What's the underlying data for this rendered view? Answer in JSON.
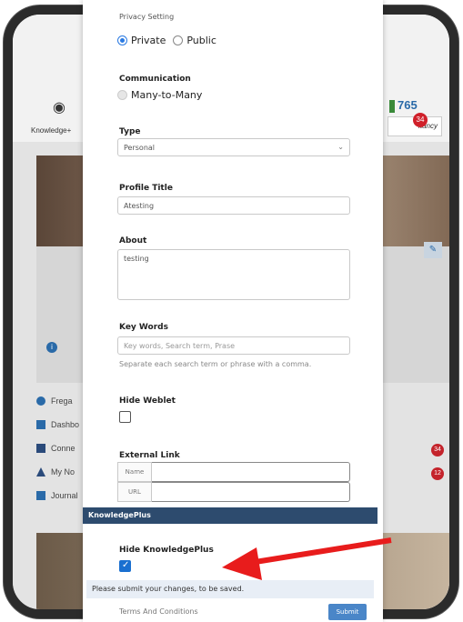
{
  "background": {
    "logo_text": "Knowledge+",
    "count": "765",
    "consult_label": "ltancy",
    "consult_badge": "34",
    "sidebar": [
      {
        "label": "Frega"
      },
      {
        "label": "Dashbo"
      },
      {
        "label": "Conne"
      },
      {
        "label": "My No"
      },
      {
        "label": "Journal"
      }
    ],
    "badge_connections": "34",
    "badge_notifications": "12"
  },
  "form": {
    "privacy": {
      "label": "Privacy Setting",
      "options": [
        "Private",
        "Public"
      ],
      "selected": "Private"
    },
    "communication": {
      "label": "Communication",
      "option": "Many-to-Many"
    },
    "type": {
      "label": "Type",
      "value": "Personal"
    },
    "profile_title": {
      "label": "Profile Title",
      "value": "Atesting"
    },
    "about": {
      "label": "About",
      "value": "testing"
    },
    "keywords": {
      "label": "Key Words",
      "placeholder": "Key words, Search term, Prase",
      "help": "Separate each search term or phrase with a comma."
    },
    "hide_weblet": {
      "label": "Hide Weblet",
      "checked": false
    },
    "external_link": {
      "label": "External Link",
      "name_label": "Name",
      "url_label": "URL"
    },
    "section_title": "KnowledgePlus",
    "hide_knowledgeplus": {
      "label": "Hide KnowledgePlus",
      "checked": true
    },
    "notice": "Please submit your changes, to be saved.",
    "terms": "Terms And Conditions",
    "submit": "Submit"
  },
  "colors": {
    "accent": "#1a6fd0",
    "section_bar": "#2d4b6e",
    "arrow": "#e81c1c"
  }
}
